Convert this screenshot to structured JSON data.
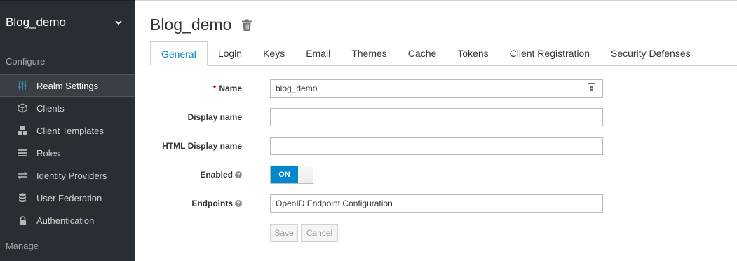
{
  "sidebar": {
    "realm_name": "Blog_demo",
    "configure_label": "Configure",
    "manage_label": "Manage",
    "items": [
      {
        "label": "Realm Settings",
        "icon": "sliders-icon",
        "active": true
      },
      {
        "label": "Clients",
        "icon": "cube-icon"
      },
      {
        "label": "Client Templates",
        "icon": "cubes-icon"
      },
      {
        "label": "Roles",
        "icon": "list-icon"
      },
      {
        "label": "Identity Providers",
        "icon": "exchange-icon"
      },
      {
        "label": "User Federation",
        "icon": "database-icon"
      },
      {
        "label": "Authentication",
        "icon": "lock-icon"
      }
    ]
  },
  "header": {
    "title": "Blog_demo"
  },
  "tabs": [
    "General",
    "Login",
    "Keys",
    "Email",
    "Themes",
    "Cache",
    "Tokens",
    "Client Registration",
    "Security Defenses"
  ],
  "form": {
    "name_label": "Name",
    "name_required": "*",
    "name_value": "blog_demo",
    "display_name_label": "Display name",
    "display_name_value": "",
    "html_display_name_label": "HTML Display name",
    "html_display_name_value": "",
    "enabled_label": "Enabled",
    "enabled_value": "ON",
    "endpoints_label": "Endpoints",
    "endpoints_value": "OpenID Endpoint Configuration",
    "help_glyph": "?"
  },
  "buttons": {
    "save": "Save",
    "cancel": "Cancel"
  },
  "colors": {
    "accent": "#0088ce",
    "sidebar_bg": "#292e34"
  }
}
